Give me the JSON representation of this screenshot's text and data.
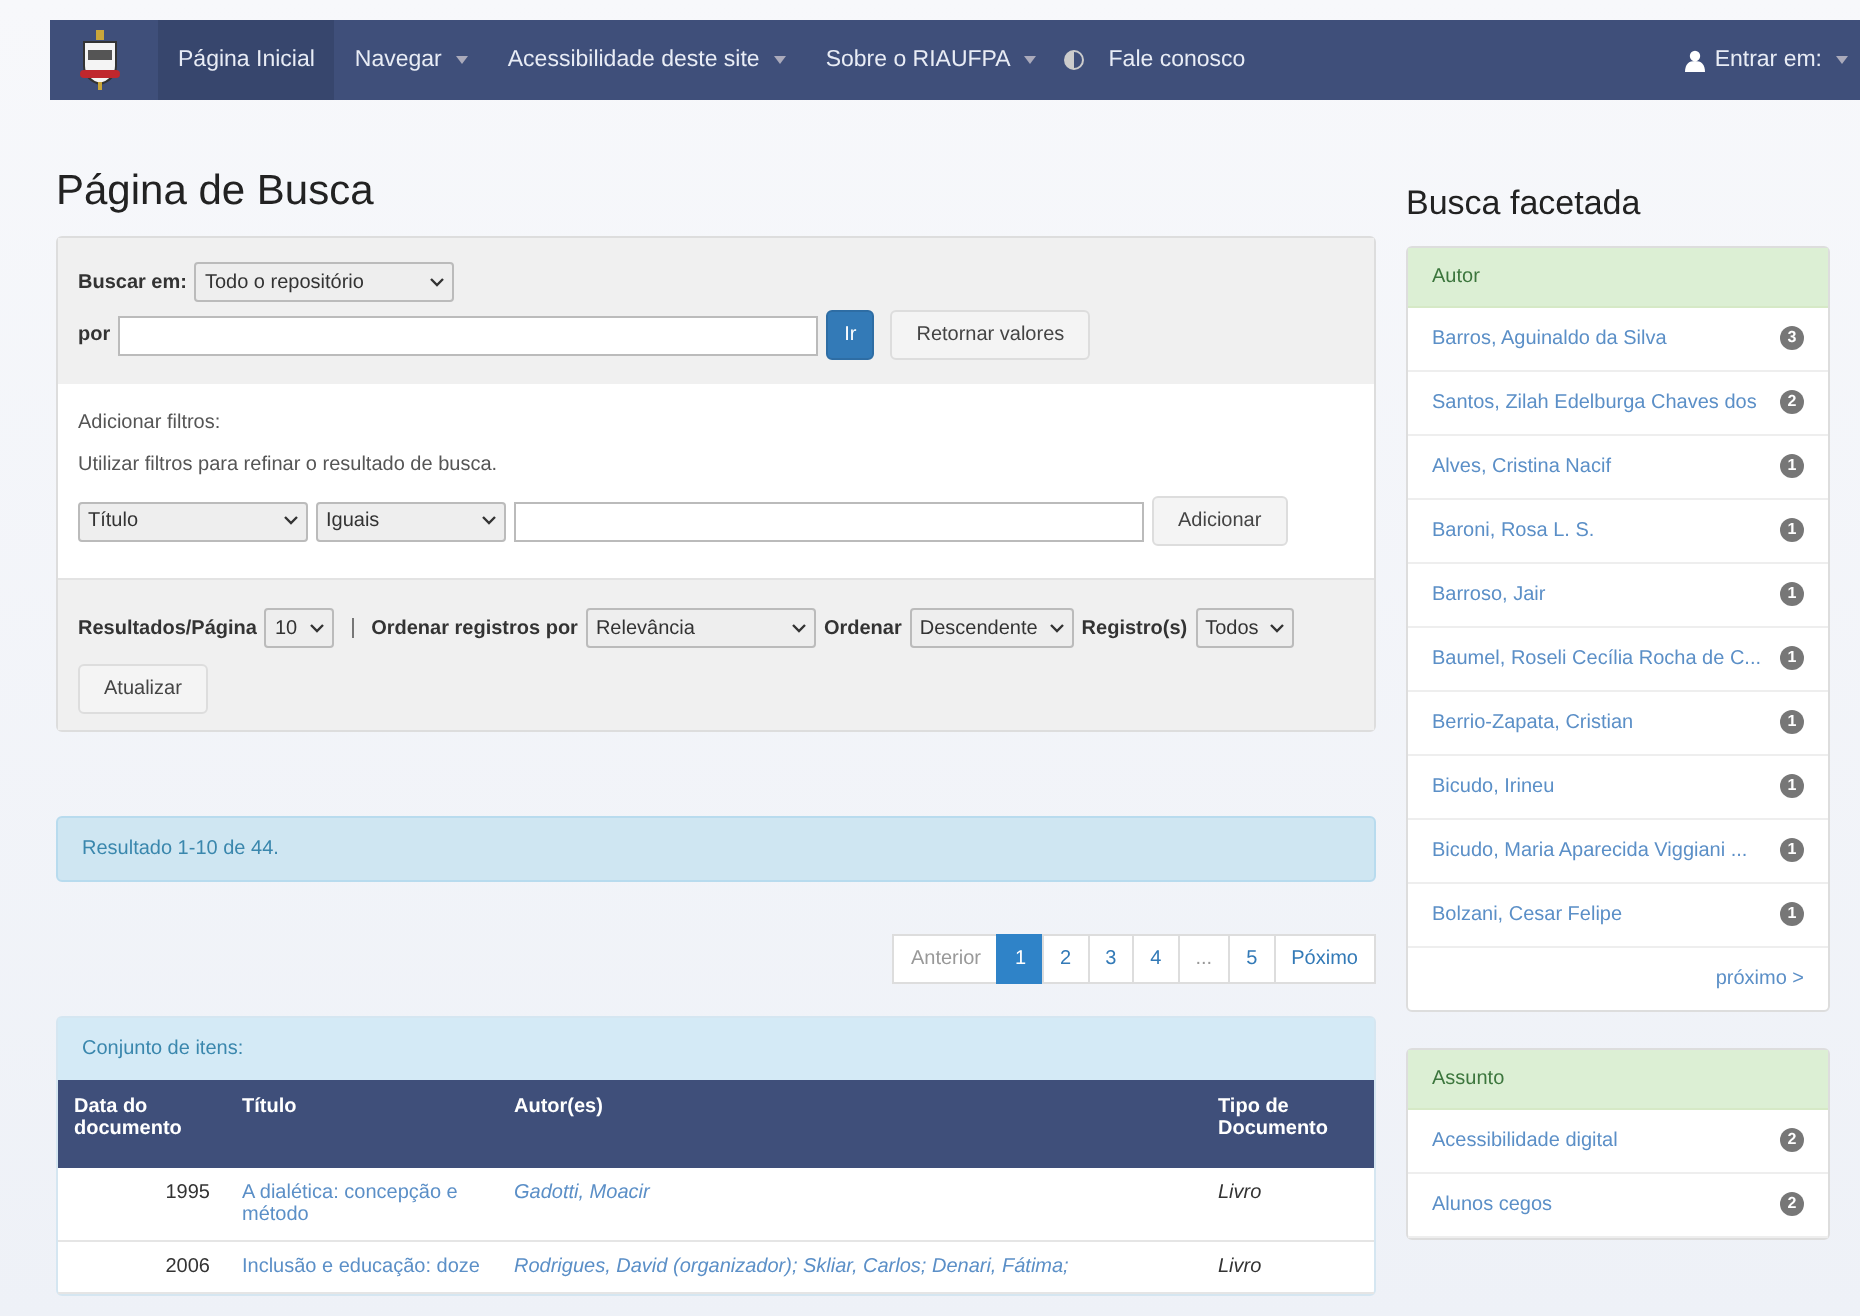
{
  "navbar": {
    "items": [
      {
        "label": "Página Inicial",
        "menu": false,
        "selected": true
      },
      {
        "label": "Navegar",
        "menu": true,
        "selected": false
      },
      {
        "label": "Acessibilidade deste site",
        "menu": true,
        "selected": false
      },
      {
        "label": "Sobre o RIAUFPA",
        "menu": true,
        "selected": false
      },
      {
        "label": "Fale conosco",
        "menu": false,
        "selected": false,
        "kind": "contrast"
      }
    ],
    "login": {
      "label": "Entrar em:",
      "menu": true
    }
  },
  "page_title": "Página de Busca",
  "search": {
    "scope_label": "Buscar em:",
    "scope": "Todo o repositório",
    "query_label": "por",
    "go_button": "Ir",
    "reset_button": "Retornar valores"
  },
  "filters": {
    "heading": "Adicionar filtros:",
    "hint": "Utilizar filtros para refinar o resultado de busca.",
    "field": "Título",
    "operator": "Iguais",
    "add_button": "Adicionar"
  },
  "options": [
    {
      "label": "Resultados/Página",
      "value": "10"
    },
    {
      "label": "Ordenar registros por",
      "value": "Relevância"
    },
    {
      "label": "Ordenar",
      "value": "Descendente"
    },
    {
      "label": "Registro(s)",
      "value": "Todos"
    }
  ],
  "update_button": "Atualizar",
  "result_summary": "Resultado 1-10 de 44.",
  "pagination": [
    {
      "label": "Anterior",
      "kind": "disabled",
      "selected": false
    },
    {
      "label": "1",
      "kind": "page",
      "selected": true
    },
    {
      "label": "2",
      "kind": "page",
      "selected": false
    },
    {
      "label": "3",
      "kind": "page",
      "selected": false
    },
    {
      "label": "4",
      "kind": "page",
      "selected": false
    },
    {
      "label": "...",
      "kind": "disabled",
      "selected": false
    },
    {
      "label": "5",
      "kind": "page",
      "selected": false
    },
    {
      "label": "Póximo",
      "kind": "page",
      "selected": false
    }
  ],
  "items_heading": "Conjunto de itens:",
  "table": {
    "columns": [
      "Data do documento",
      "Título",
      "Autor(es)",
      "Tipo de Documento"
    ],
    "rows": [
      {
        "date": "1995",
        "title": "A dialética: concepção e método",
        "authors": "Gadotti, Moacir",
        "type": "Livro"
      },
      {
        "date": "2006",
        "title": "Inclusão e educação: doze",
        "authors": "Rodrigues, David (organizador); Skliar, Carlos; Denari, Fátima;",
        "type": "Livro"
      }
    ]
  },
  "facets_title": "Busca facetada",
  "facets": [
    {
      "heading": "Autor",
      "items": [
        {
          "label": "Barros, Aguinaldo da Silva",
          "count": "3"
        },
        {
          "label": "Santos, Zilah Edelburga Chaves dos",
          "count": "2"
        },
        {
          "label": "Alves, Cristina Nacif",
          "count": "1"
        },
        {
          "label": "Baroni, Rosa L. S.",
          "count": "1"
        },
        {
          "label": "Barroso, Jair",
          "count": "1"
        },
        {
          "label": "Baumel, Roseli Cecília Rocha de C...",
          "count": "1"
        },
        {
          "label": "Berrio-Zapata, Cristian",
          "count": "1"
        },
        {
          "label": "Bicudo, Irineu",
          "count": "1"
        },
        {
          "label": "Bicudo, Maria Aparecida Viggiani ...",
          "count": "1"
        },
        {
          "label": "Bolzani, Cesar Felipe",
          "count": "1"
        }
      ],
      "next": "próximo >"
    },
    {
      "heading": "Assunto",
      "items": [
        {
          "label": "Acessibilidade digital",
          "count": "2"
        },
        {
          "label": "Alunos cegos",
          "count": "2"
        }
      ]
    }
  ]
}
